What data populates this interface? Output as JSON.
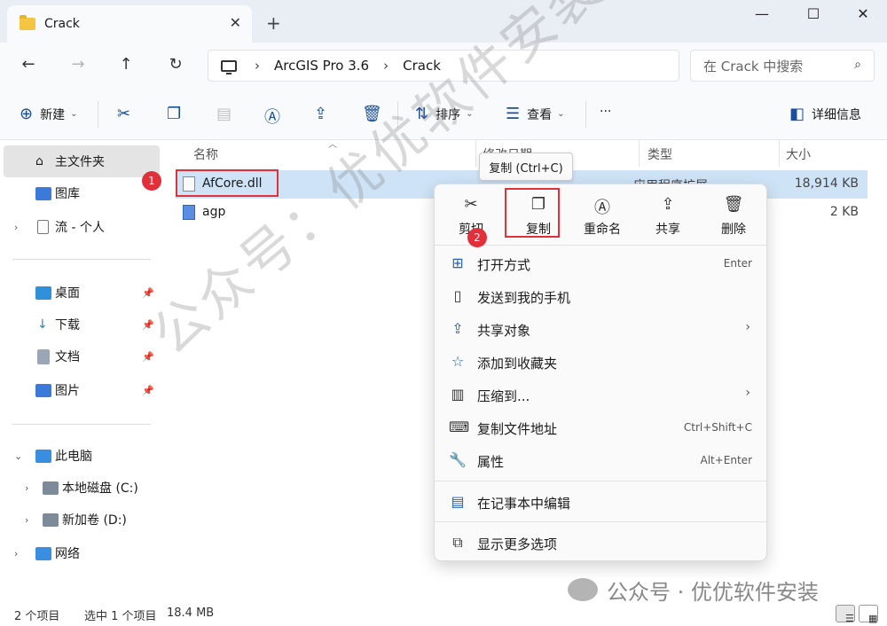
{
  "window": {
    "tab_title": "Crack",
    "close_tab": "✕",
    "new_tab": "+",
    "minimize": "—",
    "maximize": "☐",
    "close": "✕"
  },
  "nav": {
    "back": "←",
    "forward": "→",
    "up": "↑",
    "refresh": "↻",
    "breadcrumb": [
      "ArcGIS Pro 3.6",
      "Crack"
    ],
    "search_placeholder": "在 Crack 中搜索"
  },
  "command_bar": {
    "new": "新建",
    "sort": "排序",
    "view": "查看",
    "more": "···",
    "details": "详细信息"
  },
  "sidebar": {
    "items": [
      {
        "label": "主文件夹"
      },
      {
        "label": "图库"
      },
      {
        "label": "流 - 个人"
      },
      {
        "label": "桌面"
      },
      {
        "label": "下载"
      },
      {
        "label": "文档"
      },
      {
        "label": "图片"
      },
      {
        "label": "此电脑"
      },
      {
        "label": "本地磁盘 (C:)"
      },
      {
        "label": "新加卷 (D:)"
      },
      {
        "label": "网络"
      }
    ]
  },
  "columns": {
    "name": "名称",
    "modified": "修改日期",
    "type": "类型",
    "size": "大小"
  },
  "files": [
    {
      "name": "AfCore.dll",
      "type": "应用程序扩展",
      "size": "18,914 KB"
    },
    {
      "name": "agp",
      "type": "",
      "size": "2 KB"
    }
  ],
  "annotations": {
    "badge1": "1",
    "badge2": "2"
  },
  "tooltip": "复制 (Ctrl+C)",
  "context_menu": {
    "quick_actions": [
      "剪切",
      "复制",
      "重命名",
      "共享",
      "删除"
    ],
    "items": [
      {
        "label": "打开方式",
        "shortcut": "Enter"
      },
      {
        "label": "发送到我的手机",
        "shortcut": ""
      },
      {
        "label": "共享对象",
        "shortcut": ""
      },
      {
        "label": "添加到收藏夹",
        "shortcut": ""
      },
      {
        "label": "压缩到...",
        "shortcut": ""
      },
      {
        "label": "复制文件地址",
        "shortcut": "Ctrl+Shift+C"
      },
      {
        "label": "属性",
        "shortcut": "Alt+Enter"
      },
      {
        "label": "在记事本中编辑",
        "shortcut": ""
      },
      {
        "label": "显示更多选项",
        "shortcut": ""
      }
    ]
  },
  "status": {
    "count": "2 个项目",
    "selected": "选中 1 个项目",
    "size": "18.4 MB"
  },
  "watermark": {
    "diagonal": "公众号：优优软件安装",
    "footer": "公众号 · 优优软件安装"
  },
  "colors": {
    "accent": "#1a4fa0",
    "annotation_red": "#e0313b",
    "selection": "#cfe3f7"
  }
}
